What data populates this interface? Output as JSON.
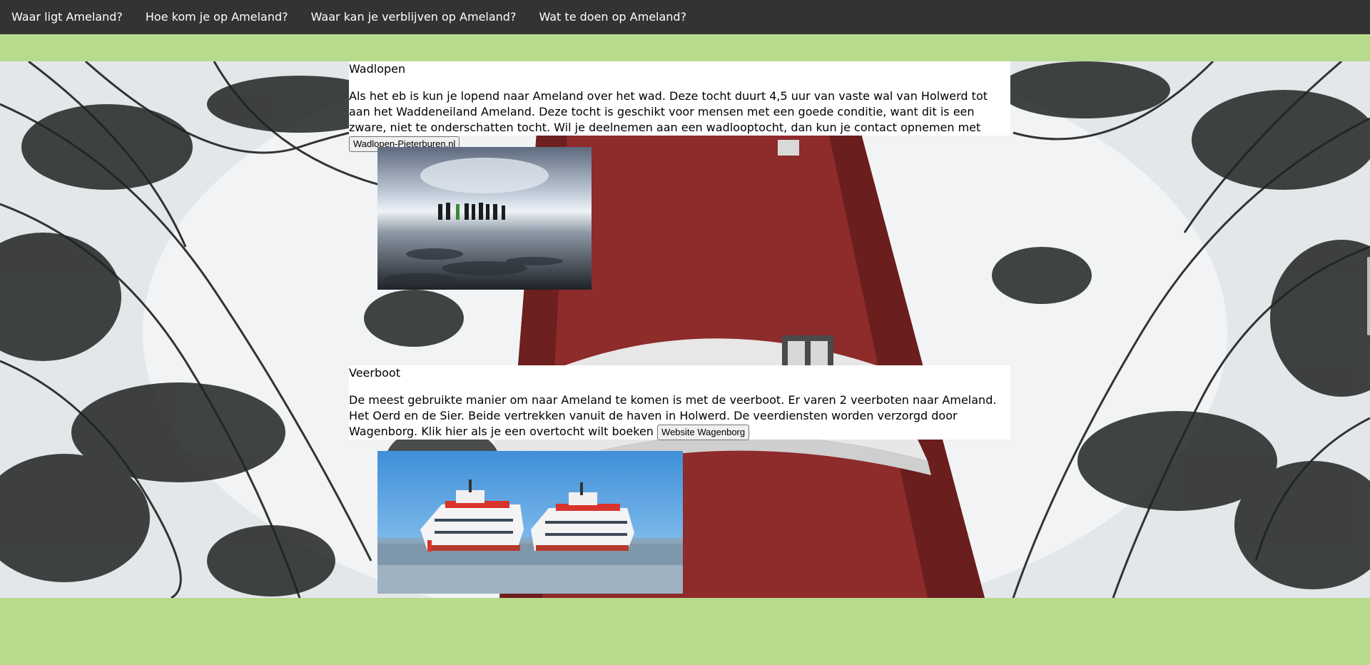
{
  "nav": {
    "items": [
      {
        "label": "Waar ligt Ameland?"
      },
      {
        "label": "Hoe kom je op Ameland?"
      },
      {
        "label": "Waar kan je verblijven op Ameland?"
      },
      {
        "label": "Wat te doen op Ameland?"
      }
    ]
  },
  "colors": {
    "nav_bg": "#333333",
    "page_bg": "#b8da8c",
    "lighthouse_red": "#8e2a2a",
    "lighthouse_white": "#e6e6e6"
  },
  "sections": [
    {
      "title": "Wadlopen",
      "text": "Als het eb is kun je lopend naar Ameland over het wad. Deze tocht duurt 4,5 uur van vaste wal van Holwerd tot aan het Waddeneiland Ameland. Deze tocht is geschikt voor mensen met een goede conditie, want dit is een zware, niet te onderschatten tocht. Wil je deelnemen aan een wadlooptocht, dan kun je contact opnemen met",
      "button": "Wadlopen-Pieterburen.nl"
    },
    {
      "title": "Veerboot",
      "text": "De meest gebruikte manier om naar Ameland te komen is met de veerboot. Er varen 2 veerboten naar Ameland. Het Oerd en de Sier. Beide vertrekken vanuit de haven in Holwerd. De veerdiensten worden verzorgd door Wagenborg. Klik hier als je een overtocht wilt boeken",
      "button": "Website Wagenborg"
    }
  ]
}
